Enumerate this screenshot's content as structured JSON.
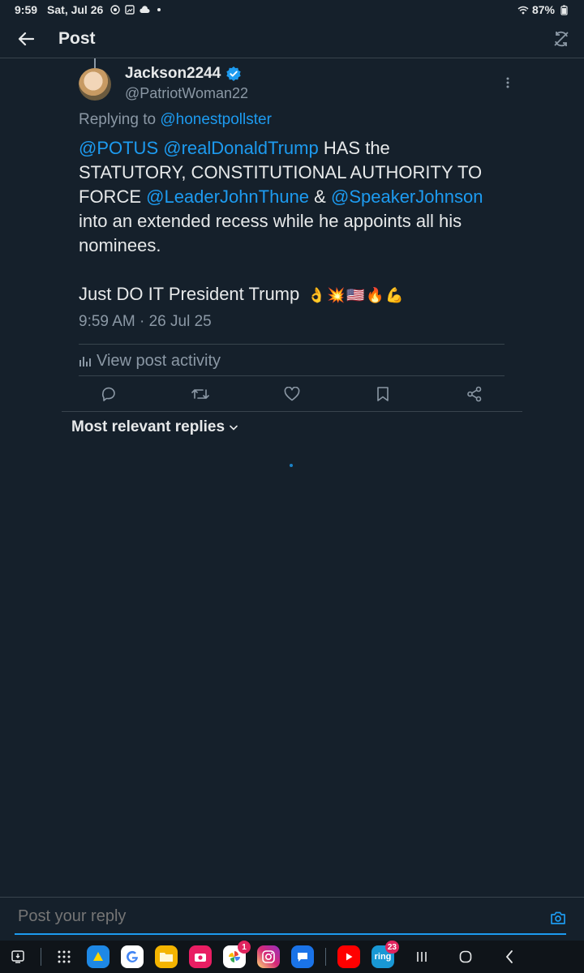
{
  "status_bar": {
    "time": "9:59",
    "date": "Sat, Jul 26",
    "battery": "87%"
  },
  "header": {
    "title": "Post"
  },
  "post": {
    "author_name": "Jackson2244",
    "author_handle": "@PatriotWoman22",
    "replying_to_label": "Replying to",
    "replying_to_handle": "@honestpollster",
    "line1_mention1": "@POTUS",
    "line1_mention2": "@realDonaldTrump",
    "line1_text": "HAS the",
    "line2_text": "STATUTORY, CONSTITUTIONAL AUTHORITY TO",
    "line3_text_a": "FORCE",
    "line3_mention1": "@LeaderJohnThune",
    "line3_amp": "&",
    "line3_mention2": "@SpeakerJohnson",
    "line4_text": "into an extended recess while he appoints all his",
    "line5_text": "nominees.",
    "line6_text": "Just DO IT President Trump",
    "emojis": [
      "👌",
      "💥",
      "🇺🇸",
      "🔥",
      "💪"
    ],
    "timestamp": "9:59 AM · 26 Jul 25"
  },
  "activity": {
    "label": "View post activity"
  },
  "replies": {
    "sort_label": "Most relevant replies"
  },
  "reply_bar": {
    "placeholder": "Post your reply"
  },
  "taskbar": {
    "apps": [
      {
        "name": "photos",
        "badge": "1"
      },
      {
        "name": "ring",
        "badge": "23"
      }
    ],
    "ring_label": "ring"
  },
  "colors": {
    "background": "#15202b",
    "accent": "#1d9bf0",
    "secondary_text": "#8b98a5",
    "divider": "#38444d"
  }
}
